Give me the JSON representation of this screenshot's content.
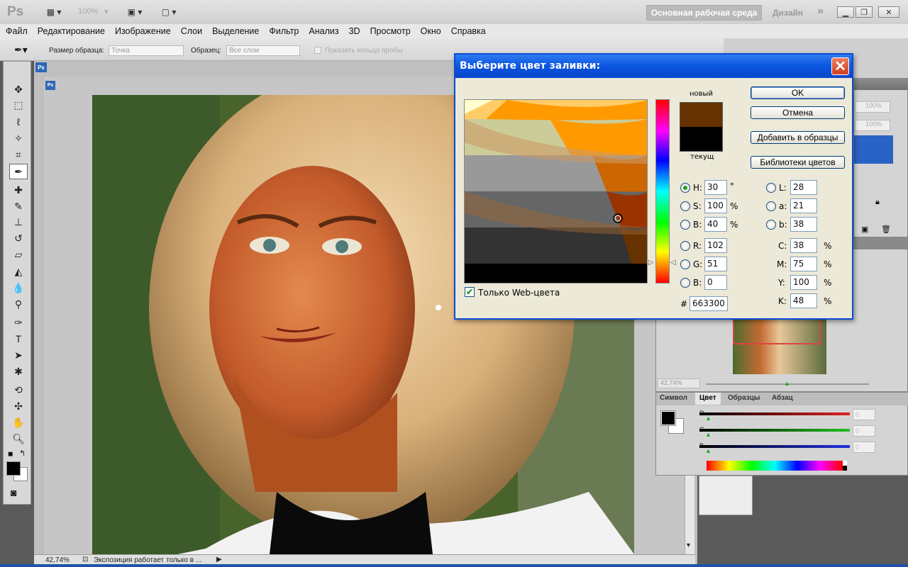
{
  "app": {
    "logo": "Ps",
    "zoom": "100%",
    "workspace": "Основная рабочая среда",
    "design": "Дизайн",
    "more": "»"
  },
  "menu": [
    "Файл",
    "Редактирование",
    "Изображение",
    "Слои",
    "Выделение",
    "Фильтр",
    "Анализ",
    "3D",
    "Просмотр",
    "Окно",
    "Справка"
  ],
  "options": {
    "sample_size_label": "Размер образца:",
    "sample_size_value": "Точка",
    "sample_label": "Образец:",
    "sample_value": "Все слои",
    "show_ring": "Показать кольцо пробы"
  },
  "document": {
    "tab": "Ps",
    "zoom": "42,74%",
    "status": "Экспозиция работает только в ..."
  },
  "dialog": {
    "title": "Выберите цвет заливки:",
    "close": "✕",
    "new_label": "новый",
    "current_label": "текущ",
    "new_color": "#663300",
    "current_color": "#000000",
    "buttons": {
      "ok": "OK",
      "cancel": "Отмена",
      "add": "Добавить в образцы",
      "libraries": "Библиотеки цветов"
    },
    "web_only": "Только Web-цвета",
    "fields": {
      "h": {
        "label": "H:",
        "value": "30",
        "unit": "°"
      },
      "s": {
        "label": "S:",
        "value": "100",
        "unit": "%"
      },
      "b": {
        "label": "B:",
        "value": "40",
        "unit": "%"
      },
      "r": {
        "label": "R:",
        "value": "102"
      },
      "g": {
        "label": "G:",
        "value": "51"
      },
      "bb": {
        "label": "B:",
        "value": "0"
      },
      "hex_label": "#",
      "hex": "663300",
      "l": {
        "label": "L:",
        "value": "28"
      },
      "a": {
        "label": "a:",
        "value": "21"
      },
      "lb": {
        "label": "b:",
        "value": "38"
      },
      "c": {
        "label": "C:",
        "value": "38",
        "unit": "%"
      },
      "m": {
        "label": "M:",
        "value": "75",
        "unit": "%"
      },
      "y": {
        "label": "Y:",
        "value": "100",
        "unit": "%"
      },
      "k": {
        "label": "K:",
        "value": "48",
        "unit": "%"
      }
    }
  },
  "layers_panel": {
    "opacity": "100%",
    "fill": "100%"
  },
  "navigator": {
    "zoom": "42,74%"
  },
  "color_panel": {
    "tabs": [
      "Символ",
      "Цвет",
      "Образцы",
      "Абзац"
    ],
    "active_tab": "Цвет",
    "r_label": "R",
    "g_label": "G",
    "b_label": "B",
    "r": "0",
    "g": "0",
    "b": "0"
  },
  "colors": {
    "accent_blue": "#0a55e0",
    "fg": "#000000",
    "bg": "#ffffff"
  }
}
